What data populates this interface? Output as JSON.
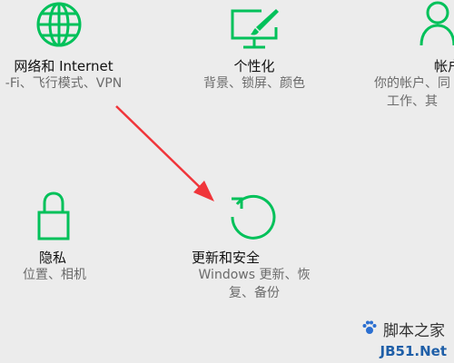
{
  "settings": {
    "accent_color": "#00c15a",
    "tiles": {
      "network": {
        "label": "网络和 Internet",
        "desc": [
          "-Fi、飞行模式、VPN"
        ],
        "icon": "globe-icon"
      },
      "personalization": {
        "label": "个性化",
        "desc": [
          "背景、锁屏、颜色"
        ],
        "icon": "personalization-icon"
      },
      "accounts": {
        "label": "帐户",
        "desc": [
          "你的帐户、同",
          "工作、其"
        ],
        "icon": "person-icon"
      },
      "privacy": {
        "label": "隐私",
        "desc": [
          "位置、相机"
        ],
        "icon": "lock-icon"
      },
      "update": {
        "label": "更新和安全",
        "desc": [
          "Windows 更新、恢",
          "复、备份"
        ],
        "icon": "refresh-icon"
      }
    },
    "annotation": {
      "arrow_color": "#f0353a"
    }
  },
  "watermark": {
    "top": "脚本之家",
    "bottom": "JB51.Net"
  }
}
